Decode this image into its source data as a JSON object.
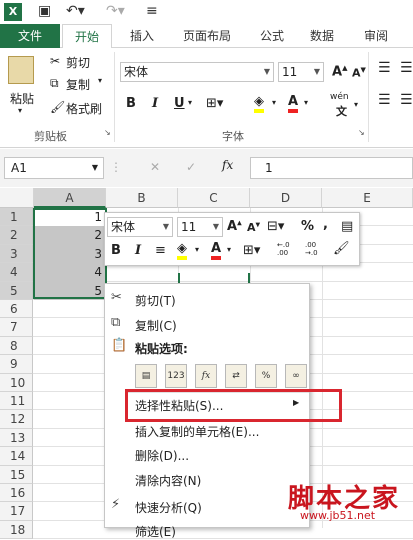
{
  "qat": {
    "app_icon": "X",
    "icons": [
      "save-icon",
      "undo-icon",
      "redo-icon"
    ]
  },
  "tabs": [
    "文件",
    "开始",
    "插入",
    "页面布局",
    "公式",
    "数据",
    "审阅"
  ],
  "clipboard": {
    "paste": "粘贴",
    "cut": "剪切",
    "copy": "复制",
    "painter": "格式刷",
    "group": "剪贴板"
  },
  "font": {
    "name": "宋体",
    "size": "11",
    "group": "字体",
    "bold": "B",
    "italic": "I",
    "underline": "U",
    "wen": "wén"
  },
  "namebox": "A1",
  "fx": "fx",
  "formula": "1",
  "columns": [
    "A",
    "B",
    "C",
    "D",
    "E"
  ],
  "rows": [
    "1",
    "2",
    "3",
    "4",
    "5",
    "6",
    "7",
    "8",
    "9",
    "10",
    "11",
    "12",
    "13",
    "14",
    "15",
    "16",
    "17",
    "18"
  ],
  "cells_a": [
    "1",
    "2",
    "3",
    "4",
    "5"
  ],
  "mini_toolbar": {
    "font": "宋体",
    "size": "11",
    "percent": "%",
    "comma": ",",
    "b": "B",
    "i": "I",
    "a": "A",
    "dec1": "←.0\n.00",
    "dec2": ".00\n→.0"
  },
  "context_menu": {
    "cut": "剪切(T)",
    "copy": "复制(C)",
    "paste_options": "粘贴选项:",
    "paste_icons": [
      "123",
      "fx",
      "%"
    ],
    "paste_special": "选择性粘贴(S)...",
    "insert_copied": "插入复制的单元格(E)...",
    "delete": "删除(D)...",
    "clear": "清除内容(N)",
    "quick_analysis": "快速分析(Q)",
    "filter": "筛选(E)"
  },
  "watermark": {
    "text": "脚本之家",
    "url": "www.jb51.net"
  },
  "colors": {
    "accent": "#217346",
    "highlight": "#d9262f"
  }
}
